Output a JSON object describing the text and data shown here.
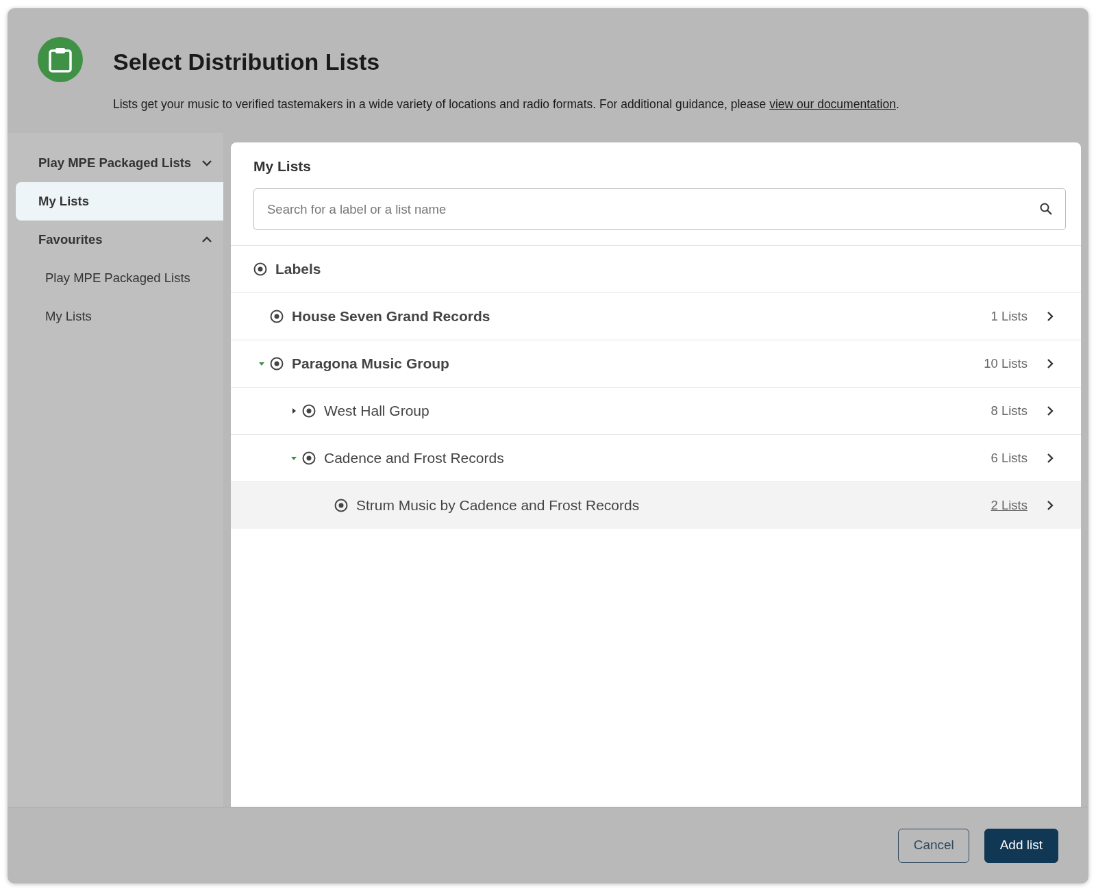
{
  "header": {
    "title": "Select Distribution Lists",
    "description": "Lists get your music to verified tastemakers in a wide variety of locations and radio formats. For additional guidance, please ",
    "link": "view our documentation",
    "after_link": "."
  },
  "sidebar": {
    "items": [
      {
        "label": "Play MPE Packaged Lists",
        "kind": "section",
        "expanded": false,
        "selected": false
      },
      {
        "label": "My Lists",
        "kind": "item",
        "selected": true
      },
      {
        "label": "Favourites",
        "kind": "section",
        "expanded": true,
        "selected": false,
        "children": [
          {
            "label": "Play MPE Packaged Lists",
            "selected": false
          },
          {
            "label": "My Lists",
            "selected": false
          }
        ]
      }
    ]
  },
  "panel": {
    "title": "My Lists",
    "search": {
      "placeholder": "Search for a label or a list name"
    },
    "tree": {
      "label": "Labels",
      "children": [
        {
          "label": "House Seven Grand Records",
          "count": "1 Lists",
          "hovered": false
        },
        {
          "label": "Paragona Music Group",
          "count": "10 Lists",
          "expanded": true,
          "hovered": false,
          "children": [
            {
              "label": "West Hall Group",
              "count": "8 Lists",
              "expanded": false,
              "hovered": false
            },
            {
              "label": "Cadence and Frost Records",
              "count": "6 Lists",
              "expanded": true,
              "hovered": false,
              "children": [
                {
                  "label": "Strum Music by Cadence and Frost Records",
                  "count": "2 Lists",
                  "hovered": true
                }
              ]
            }
          ]
        }
      ]
    }
  },
  "footer": {
    "buttons": [
      {
        "label": "Cancel",
        "kind": "secondary"
      },
      {
        "label": "Add list",
        "kind": "primary"
      }
    ]
  }
}
